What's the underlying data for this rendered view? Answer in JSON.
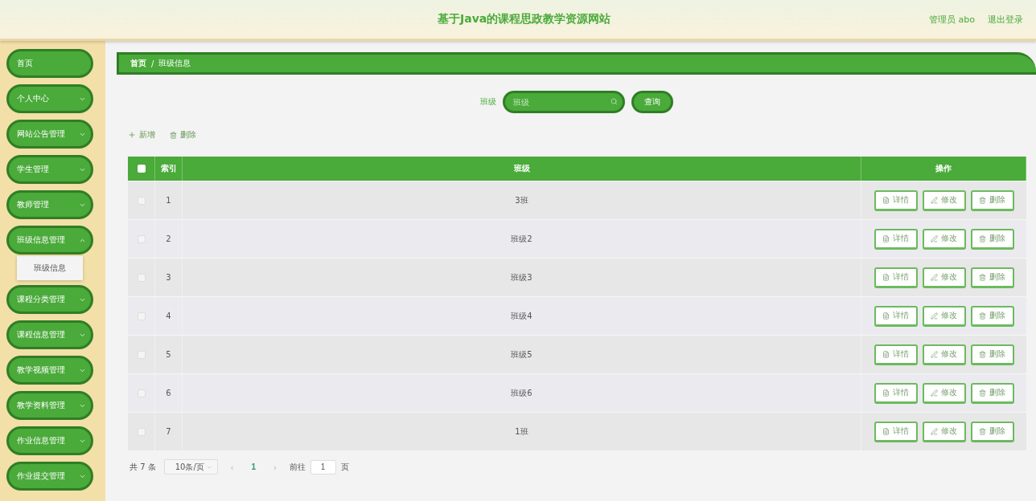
{
  "header": {
    "title": "基于Java的课程思政教学资源网站",
    "user": "管理员 abo",
    "logout": "退出登录"
  },
  "sidebar": {
    "items": [
      {
        "label": "首页",
        "kind": "link"
      },
      {
        "label": "个人中心",
        "kind": "menu",
        "expanded": false
      },
      {
        "label": "网站公告管理",
        "kind": "menu",
        "expanded": false
      },
      {
        "label": "学生管理",
        "kind": "menu",
        "expanded": false
      },
      {
        "label": "教师管理",
        "kind": "menu",
        "expanded": false
      },
      {
        "label": "班级信息管理",
        "kind": "menu",
        "expanded": true,
        "children": [
          {
            "label": "班级信息"
          }
        ]
      },
      {
        "label": "课程分类管理",
        "kind": "menu",
        "expanded": false
      },
      {
        "label": "课程信息管理",
        "kind": "menu",
        "expanded": false
      },
      {
        "label": "教学视频管理",
        "kind": "menu",
        "expanded": false
      },
      {
        "label": "教学资料管理",
        "kind": "menu",
        "expanded": false
      },
      {
        "label": "作业信息管理",
        "kind": "menu",
        "expanded": false
      },
      {
        "label": "作业提交管理",
        "kind": "menu",
        "expanded": false
      }
    ]
  },
  "breadcrumb": {
    "items": [
      "首页",
      "班级信息"
    ],
    "separator": "/"
  },
  "search": {
    "label": "班级",
    "placeholder": "班级",
    "button": "查询"
  },
  "toolbar": {
    "add": "新增",
    "delete": "删除"
  },
  "table": {
    "columns": [
      "索引",
      "班级",
      "操作"
    ],
    "all_checked": false,
    "rows": [
      {
        "index": "1",
        "class": "3班",
        "checked": false,
        "actions": [
          "详情",
          "修改",
          "删除"
        ]
      },
      {
        "index": "2",
        "class": "班级2",
        "checked": false,
        "actions": [
          "详情",
          "修改",
          "删除"
        ]
      },
      {
        "index": "3",
        "class": "班级3",
        "checked": false,
        "actions": [
          "详情",
          "修改",
          "删除"
        ]
      },
      {
        "index": "4",
        "class": "班级4",
        "checked": false,
        "actions": [
          "详情",
          "修改",
          "删除"
        ]
      },
      {
        "index": "5",
        "class": "班级5",
        "checked": false,
        "actions": [
          "详情",
          "修改",
          "删除"
        ]
      },
      {
        "index": "6",
        "class": "班级6",
        "checked": false,
        "actions": [
          "详情",
          "修改",
          "删除"
        ]
      },
      {
        "index": "7",
        "class": "1班",
        "checked": false,
        "actions": [
          "详情",
          "修改",
          "删除"
        ]
      }
    ]
  },
  "pagination": {
    "total": "共 7 条",
    "page_size": "10条/页",
    "prev": "‹",
    "pages": [
      {
        "label": "1",
        "selected": true
      }
    ],
    "next": "›",
    "goto": "前往",
    "goto_value": "1",
    "page_unit": "页"
  }
}
